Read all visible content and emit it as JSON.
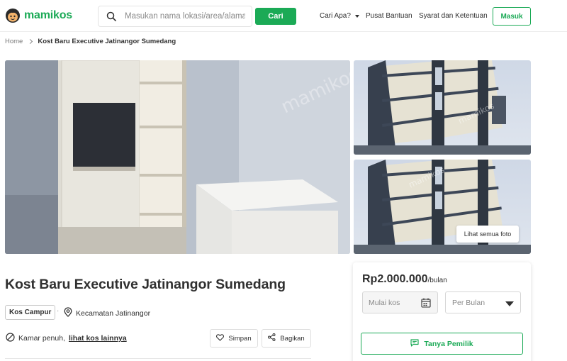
{
  "header": {
    "logo_text": "mamikos",
    "search": {
      "placeholder": "Masukan nama lokasi/area/alamat",
      "button_label": "Cari"
    },
    "nav": {
      "cari_apa": "Cari Apa?",
      "pusat_bantuan": "Pusat Bantuan",
      "syarat": "Syarat dan Ketentuan"
    },
    "login_label": "Masuk"
  },
  "breadcrumb": {
    "home": "Home",
    "current": "Kost Baru Executive Jatinangor Sumedang"
  },
  "gallery": {
    "see_all_label": "Lihat semua foto",
    "watermark": "mamikos"
  },
  "listing": {
    "title": "Kost Baru Executive Jatinangor Sumedang",
    "type": "Kos Campur",
    "separator": "·",
    "location": "Kecamatan Jatinangor",
    "status_text": "Kamar penuh,",
    "status_link": "lihat kos lainnya",
    "save_label": "Simpan",
    "share_label": "Bagikan"
  },
  "booking": {
    "price": "Rp2.000.000",
    "price_unit": "/bulan",
    "start_placeholder": "Mulai kos",
    "period_value": "Per Bulan",
    "ask_label": "Tanya Pemilik"
  },
  "colors": {
    "brand_green": "#1baa56",
    "text": "#303030"
  },
  "icons": [
    "logo-icon",
    "search-icon",
    "chevron-down-icon",
    "chevron-right-icon",
    "location-pin-icon",
    "no-entry-icon",
    "heart-icon",
    "share-icon",
    "calendar-icon",
    "chat-icon"
  ]
}
